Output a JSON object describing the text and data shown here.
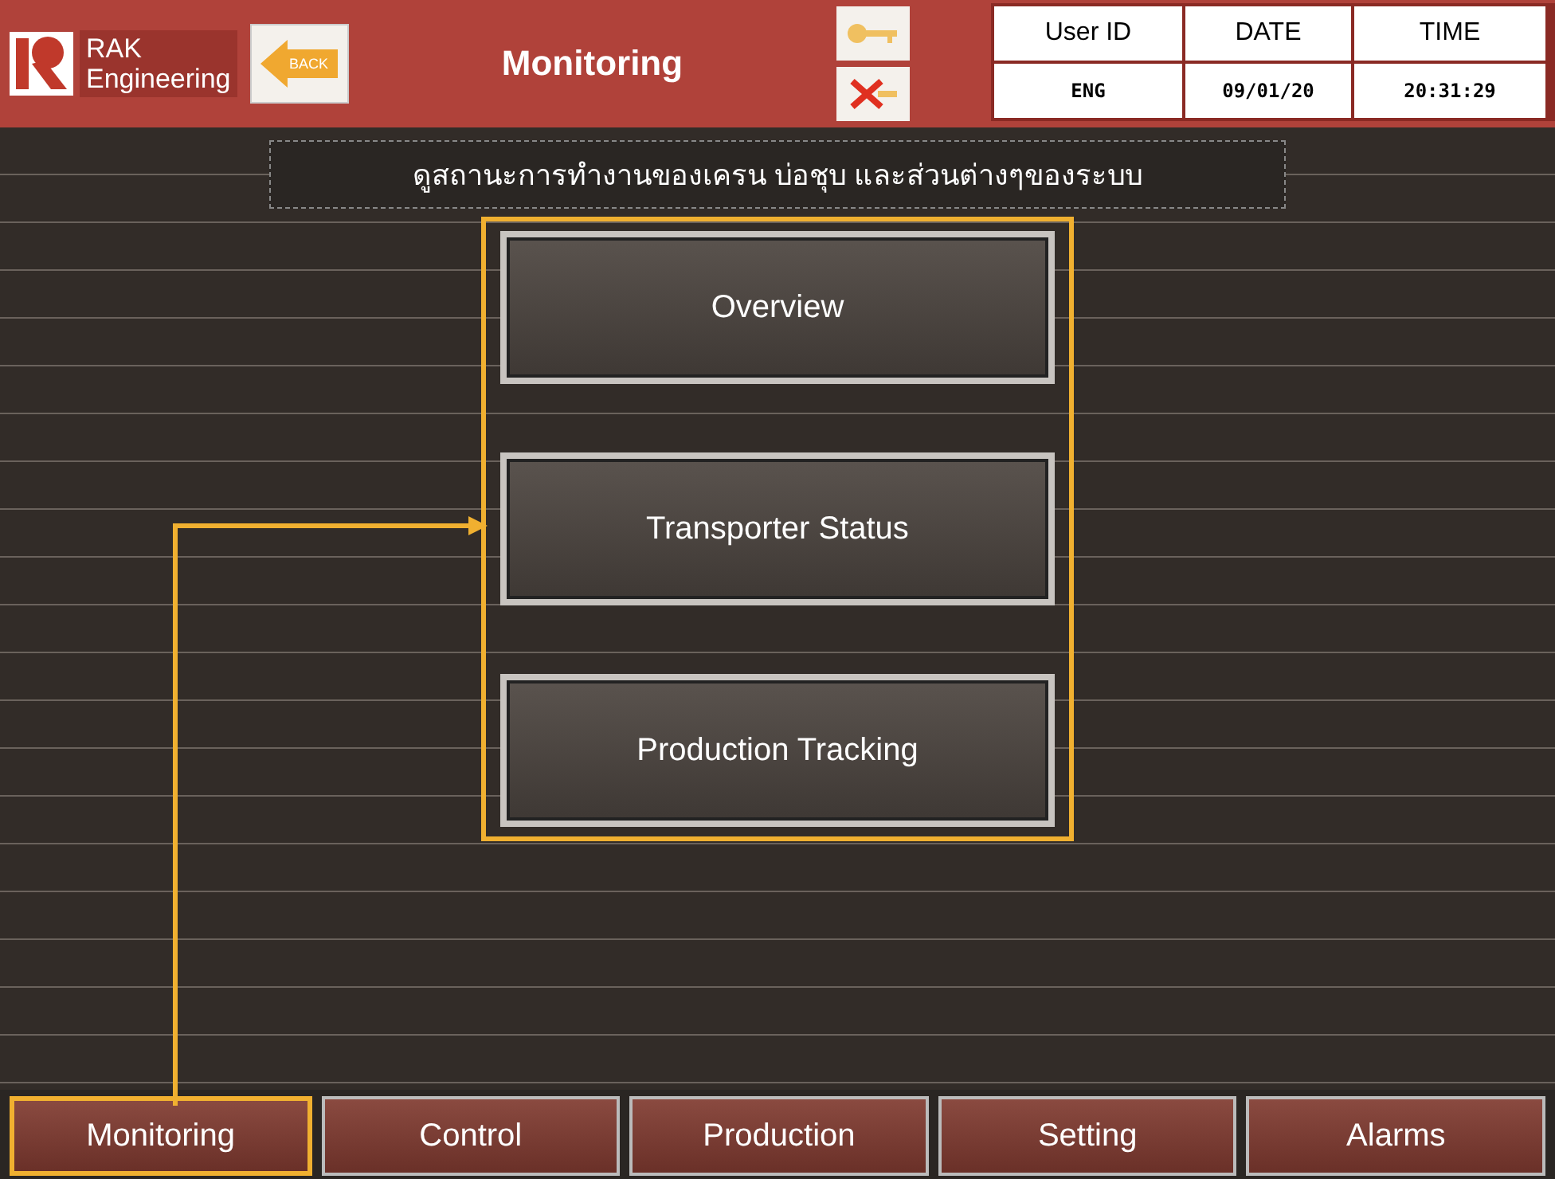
{
  "header": {
    "brand": [
      "RAK",
      "Engineering"
    ],
    "back_button": "BACK",
    "title": "Monitoring",
    "info": {
      "columns": [
        "User ID",
        "DATE",
        "TIME"
      ],
      "values": [
        "ENG",
        "09/01/20",
        "20:31:29"
      ]
    }
  },
  "description": "ดูสถานะการทำงานของเครน บ่อชุบ และส่วนต่างๆของระบบ",
  "menu": [
    "Overview",
    "Transporter Status",
    "Production Tracking"
  ],
  "tabs": [
    {
      "label": "Monitoring",
      "selected": true
    },
    {
      "label": "Control",
      "selected": false
    },
    {
      "label": "Production",
      "selected": false
    },
    {
      "label": "Setting",
      "selected": false
    },
    {
      "label": "Alarms",
      "selected": false
    }
  ]
}
